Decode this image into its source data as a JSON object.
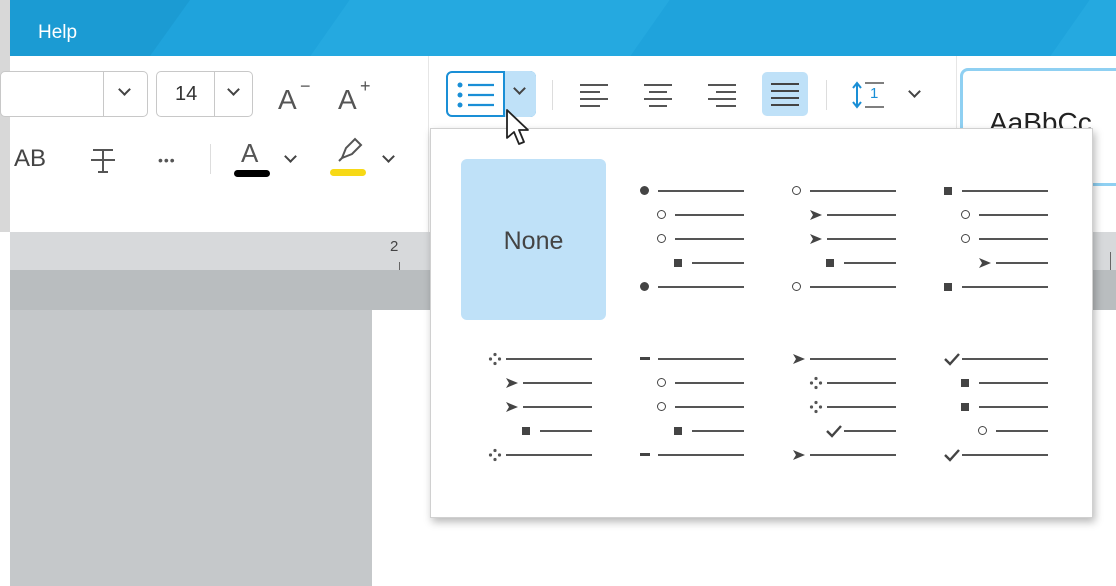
{
  "menubar": {
    "items": [
      "Help"
    ]
  },
  "ribbon": {
    "font_size": "14",
    "font_grow_label": "A",
    "font_grow_sup": "+",
    "font_shrink_label": "A",
    "font_shrink_sup": "−",
    "caps_label": "AB",
    "more_label": "•••",
    "style_preview_text": "AaBbCc",
    "ruler_label": "2",
    "font_color": "#000000",
    "highlight_color": "#f7d916",
    "line_spacing_num": "1"
  },
  "bullet_panel": {
    "none_label": "None",
    "options": [
      {
        "name": "none",
        "selected": true
      },
      {
        "name": "disc-circle-square",
        "levels": [
          [
            "disc",
            0
          ],
          [
            "circle",
            1
          ],
          [
            "circle",
            1
          ],
          [
            "square",
            2
          ],
          [
            "disc",
            0
          ]
        ]
      },
      {
        "name": "circle-arrow-square",
        "levels": [
          [
            "circle",
            0
          ],
          [
            "arrow",
            1
          ],
          [
            "arrow",
            1
          ],
          [
            "square",
            2
          ],
          [
            "circle",
            0
          ]
        ]
      },
      {
        "name": "square-circle-arrow",
        "levels": [
          [
            "square",
            0
          ],
          [
            "circle",
            1
          ],
          [
            "circle",
            1
          ],
          [
            "arrow",
            2
          ],
          [
            "square",
            0
          ]
        ]
      },
      {
        "name": "diamond-arrow-square",
        "levels": [
          [
            "diamond",
            0
          ],
          [
            "arrow",
            1
          ],
          [
            "arrow",
            1
          ],
          [
            "square",
            2
          ],
          [
            "diamond",
            0
          ]
        ]
      },
      {
        "name": "dash-circle-square",
        "levels": [
          [
            "dash",
            0
          ],
          [
            "circle",
            1
          ],
          [
            "circle",
            1
          ],
          [
            "square",
            2
          ],
          [
            "dash",
            0
          ]
        ]
      },
      {
        "name": "arrow-diamond-check",
        "levels": [
          [
            "arrow",
            0
          ],
          [
            "diamond",
            1
          ],
          [
            "diamond",
            1
          ],
          [
            "check",
            2
          ],
          [
            "arrow",
            0
          ]
        ]
      },
      {
        "name": "check-square-circle",
        "levels": [
          [
            "check",
            0
          ],
          [
            "square",
            1
          ],
          [
            "square",
            1
          ],
          [
            "circle",
            2
          ],
          [
            "check",
            0
          ]
        ]
      }
    ]
  },
  "colors": {
    "menubar": "#1fa3dc",
    "selection": "#bfe1f8",
    "accent": "#1a8fd6"
  }
}
